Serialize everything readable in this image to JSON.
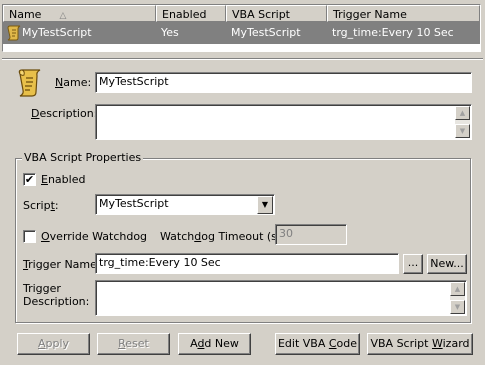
{
  "list": {
    "columns": [
      "Name",
      "Enabled",
      "VBA Script",
      "Trigger Name"
    ],
    "sort_indicator": "△",
    "rows": [
      {
        "icon": "script-icon",
        "name": "MyTestScript",
        "enabled": "Yes",
        "vba_script": "MyTestScript",
        "trigger_name": "trg_time:Every 10 Sec",
        "selected": true
      }
    ]
  },
  "form": {
    "name_label_underlined": "N",
    "name_label_rest": "ame:",
    "name_value": "MyTestScript",
    "description_label_underlined": "D",
    "description_label_rest": "escription:",
    "description_value": "",
    "group_title": "VBA Script Properties",
    "enabled_label_underlined": "E",
    "enabled_label_rest": "nabled",
    "enabled_checked": "✔",
    "script_label_pre": "Scrip",
    "script_label_underlined": "t",
    "script_label_rest": ":",
    "script_value": "MyTestScript",
    "override_label_underlined": "O",
    "override_label_rest": "verride Watchdog",
    "watchdog_label_pre": "Watch",
    "watchdog_label_underlined": "d",
    "watchdog_label_rest": "og Timeout (s):",
    "watchdog_value": "30",
    "trigger_label_underlined": "T",
    "trigger_label_rest": "rigger Name:",
    "trigger_value": "trg_time:Every 10 Sec",
    "browse_button": "...",
    "new_button": "New...",
    "trigger_desc_label_1": "Trigger",
    "trigger_desc_label_2": "Description:",
    "trigger_desc_value": ""
  },
  "buttons": {
    "apply_u": "A",
    "apply_rest": "pply",
    "reset_u": "R",
    "reset_rest": "eset",
    "addnew_pre": "A",
    "addnew_u": "d",
    "addnew_rest": "d New",
    "editvba_pre": "Edit VBA ",
    "editvba_u": "C",
    "editvba_rest": "ode",
    "wizard_pre": "VBA Script ",
    "wizard_u": "W",
    "wizard_rest": "izard"
  },
  "colors": {
    "face": "#d4d0c8",
    "selection": "#808080",
    "script_icon": "#e0b84a"
  }
}
